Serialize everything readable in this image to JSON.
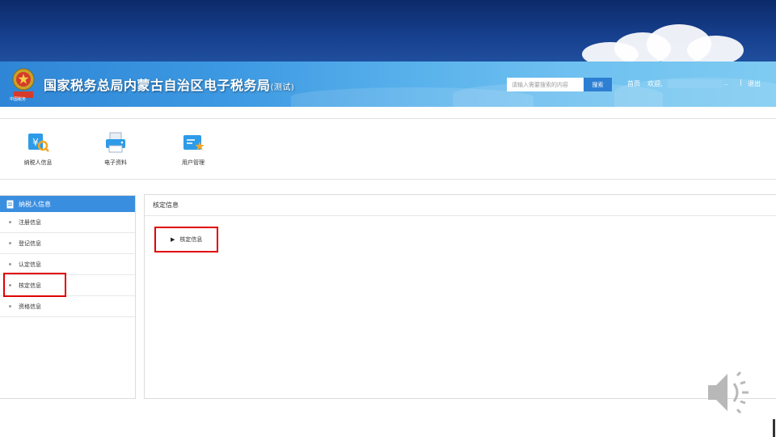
{
  "header": {
    "title": "国家税务总局内蒙古自治区电子税务局",
    "title_suffix": "(测试)",
    "emblem_text": "中国税务",
    "search": {
      "placeholder": "请输入需要搜索的内容",
      "button": "搜索"
    },
    "nav": {
      "home": "首页",
      "welcome": "欢迎,",
      "ellipsis": "..",
      "separator": "|",
      "logout": "退出"
    }
  },
  "modules": [
    {
      "label": "纳税人信息",
      "icon": "taxpayer-search-icon"
    },
    {
      "label": "电子资料",
      "icon": "printer-document-icon"
    },
    {
      "label": "用户管理",
      "icon": "user-card-star-icon"
    }
  ],
  "sidebar": {
    "header": "纳税人信息",
    "items": [
      {
        "label": "注册信息"
      },
      {
        "label": "登记信息"
      },
      {
        "label": "认定信息"
      },
      {
        "label": "核定信息"
      },
      {
        "label": "资格信息"
      }
    ]
  },
  "main": {
    "title": "核定信息",
    "tree_item": "核定信息"
  },
  "colors": {
    "banner_dark": "#0c2a6a",
    "banner_light": "#5bb3ec",
    "accent": "#3a8ee0",
    "annotation": "#e00000"
  }
}
